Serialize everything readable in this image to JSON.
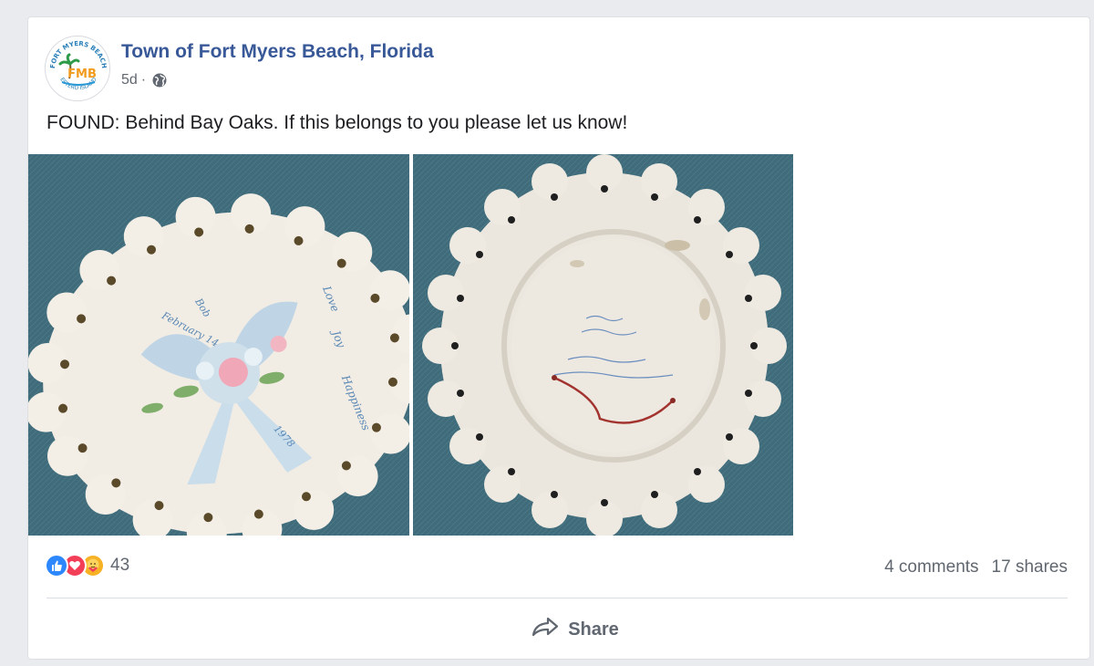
{
  "post": {
    "page_name": "Town of Fort Myers Beach, Florida",
    "time": "5d",
    "separator": "·",
    "audience_icon": "globe-icon",
    "text": "FOUND: Behind Bay Oaks. If this belongs to you please let us know!"
  },
  "avatar": {
    "logo_text": "FMB",
    "ring_text_top": "FORT MYERS BEACH",
    "ring_text_bottom": "ESTERO ISLAND"
  },
  "photos": [
    {
      "name": "plate-front-photo",
      "plate_text": [
        "February 14",
        "Bob",
        "1978",
        "Love",
        "Joy",
        "Happiness"
      ]
    },
    {
      "name": "plate-back-photo",
      "plate_text": []
    }
  ],
  "reactions": {
    "icons": [
      "like-icon",
      "love-icon",
      "care-icon"
    ],
    "count": "43"
  },
  "counts": {
    "comments": "4 comments",
    "shares": "17 shares"
  },
  "actions": {
    "share_label": "Share"
  },
  "colors": {
    "page_background": "#e9ebee",
    "link_blue": "#385898",
    "like_blue": "#2d88ff",
    "love_red": "#f33e58",
    "care_yellow": "#f7b125",
    "photo_backdrop": "#3f6b7a"
  }
}
